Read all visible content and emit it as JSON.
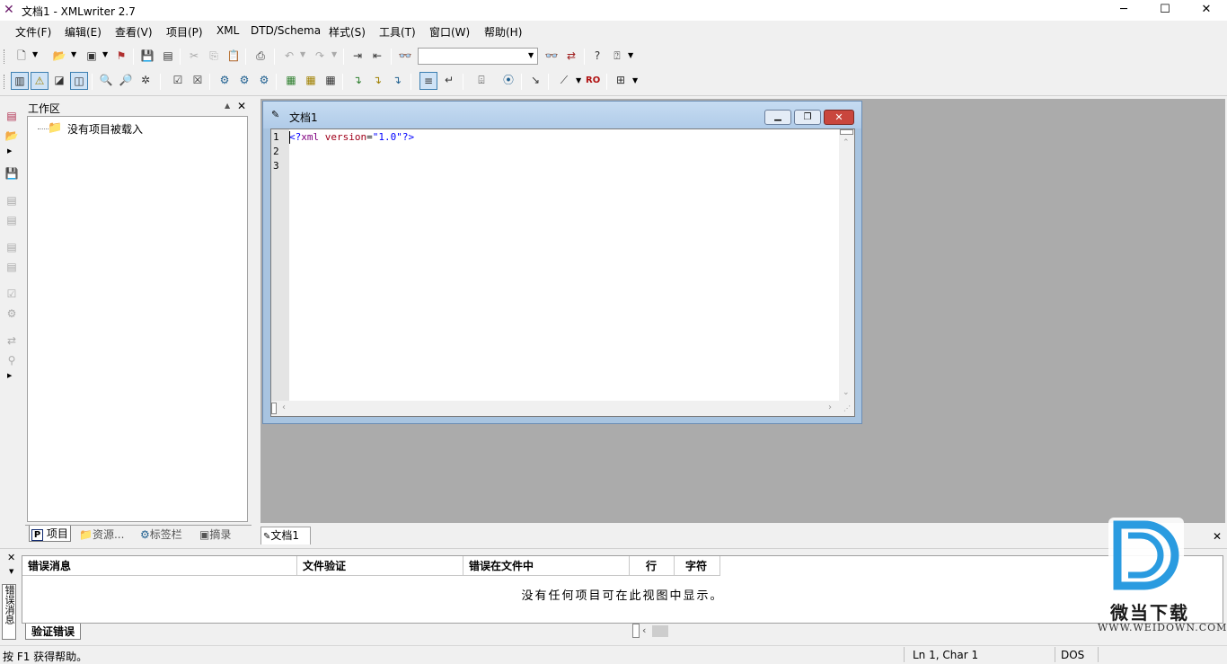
{
  "app": {
    "title": "文档1 - XMLwriter 2.7",
    "icon": "xmlwriter-app-icon"
  },
  "window_controls": {
    "minimize": "─",
    "maximize": "☐",
    "close": "✕"
  },
  "menu": [
    "文件(F)",
    "编辑(E)",
    "查看(V)",
    "项目(P)",
    "XML",
    "DTD/Schema",
    "样式(S)",
    "工具(T)",
    "窗口(W)",
    "帮助(H)"
  ],
  "toolbar": {
    "search_value": "",
    "toggle_ro_label": "RO"
  },
  "workspace": {
    "title": "工作区",
    "pin": "▲",
    "close": "✕",
    "tree_root": "没有项目被载入",
    "tabs": [
      "项目",
      "资源...",
      "标签栏",
      "摘录"
    ]
  },
  "document": {
    "title": "文档1",
    "line_numbers": [
      "1",
      "2",
      "3"
    ],
    "code": {
      "open": "<?",
      "tag": "xml",
      "attr": " version",
      "eq": "=",
      "value": "\"1.0\"",
      "close": "?>"
    },
    "tab_label": "文档1"
  },
  "errors_panel": {
    "side_label": "错误消息",
    "columns": [
      "错误消息",
      "文件验证",
      "错误在文件中",
      "行",
      "字符"
    ],
    "empty_message": "没有任何项目可在此视图中显示。",
    "tab_label": "验证错误"
  },
  "status": {
    "help": "按 F1 获得帮助。",
    "position": "Ln 1, Char 1",
    "line_ending": "DOS"
  },
  "watermark": {
    "cn": "微当下载",
    "en": "WWW.WEIDOWN.COM"
  },
  "colors": {
    "mdi_background": "#ababab",
    "doc_frame": "#a8c4e0",
    "xml_tag": "#800080",
    "xml_attr": "#a0001a",
    "xml_value": "#0000ff",
    "watermark_blue": "#2a9be0"
  }
}
